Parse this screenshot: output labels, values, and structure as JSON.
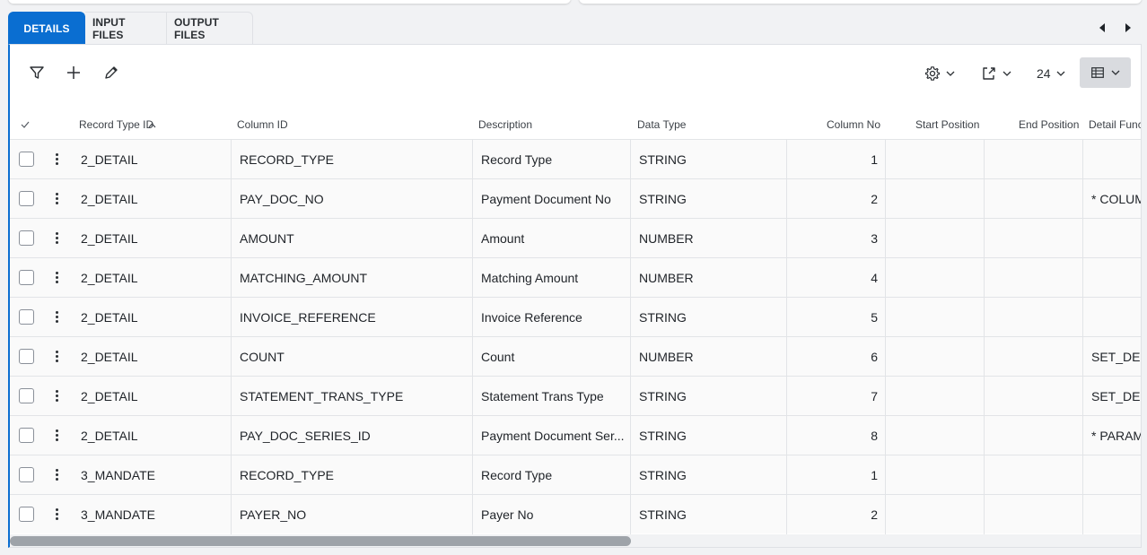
{
  "tabs": [
    "DETAILS",
    "INPUT FILES",
    "OUTPUT FILES"
  ],
  "toolbar": {
    "page_size": "24"
  },
  "columns": [
    "Record Type ID",
    "Column ID",
    "Description",
    "Data Type",
    "Column No",
    "Start Position",
    "End Position",
    "Detail Func"
  ],
  "rows": [
    {
      "record_type": "2_DETAIL",
      "column_id": "RECORD_TYPE",
      "description": "Record Type",
      "data_type": "STRING",
      "column_no": "1",
      "detail": ""
    },
    {
      "record_type": "2_DETAIL",
      "column_id": "PAY_DOC_NO",
      "description": "Payment Document No",
      "data_type": "STRING",
      "column_no": "2",
      "detail": "* COLUM"
    },
    {
      "record_type": "2_DETAIL",
      "column_id": "AMOUNT",
      "description": "Amount",
      "data_type": "NUMBER",
      "column_no": "3",
      "detail": ""
    },
    {
      "record_type": "2_DETAIL",
      "column_id": "MATCHING_AMOUNT",
      "description": "Matching Amount",
      "data_type": "NUMBER",
      "column_no": "4",
      "detail": ""
    },
    {
      "record_type": "2_DETAIL",
      "column_id": "INVOICE_REFERENCE",
      "description": "Invoice Reference",
      "data_type": "STRING",
      "column_no": "5",
      "detail": ""
    },
    {
      "record_type": "2_DETAIL",
      "column_id": "COUNT",
      "description": "Count",
      "data_type": "NUMBER",
      "column_no": "6",
      "detail": "SET_DEFA"
    },
    {
      "record_type": "2_DETAIL",
      "column_id": "STATEMENT_TRANS_TYPE",
      "description": "Statement Trans Type",
      "data_type": "STRING",
      "column_no": "7",
      "detail": "SET_DEFA"
    },
    {
      "record_type": "2_DETAIL",
      "column_id": "PAY_DOC_SERIES_ID",
      "description": "Payment Document Ser...",
      "data_type": "STRING",
      "column_no": "8",
      "detail": "* PARAM"
    },
    {
      "record_type": "3_MANDATE",
      "column_id": "RECORD_TYPE",
      "description": "Record Type",
      "data_type": "STRING",
      "column_no": "1",
      "detail": ""
    },
    {
      "record_type": "3_MANDATE",
      "column_id": "PAYER_NO",
      "description": "Payer No",
      "data_type": "STRING",
      "column_no": "2",
      "detail": ""
    }
  ]
}
